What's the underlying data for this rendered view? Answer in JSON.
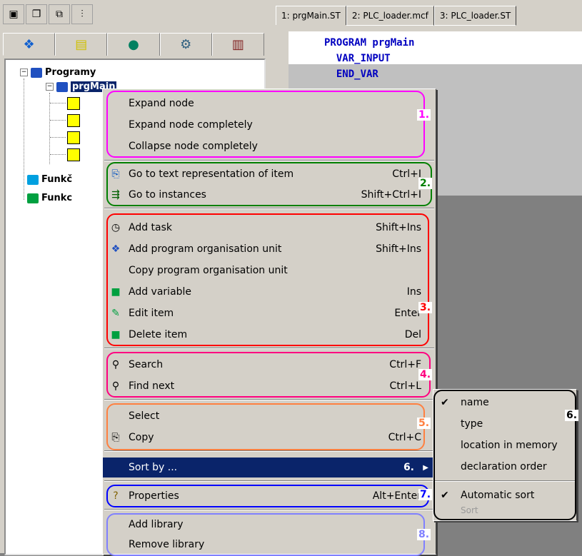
{
  "left_panel": {
    "tree": {
      "programs_label": "Programy",
      "selected_node": "prgMain",
      "functions_label_1": "Funkč",
      "functions_label_2": "Funkc"
    }
  },
  "editor": {
    "tabs": [
      {
        "label": "1: prgMain.ST"
      },
      {
        "label": "2: PLC_loader.mcf"
      },
      {
        "label": "3: PLC_loader.ST"
      }
    ],
    "code_lines": [
      {
        "text": "PROGRAM prgMain"
      },
      {
        "text": "  VAR_INPUT"
      },
      {
        "text": "  END_VAR"
      }
    ]
  },
  "context_menu": {
    "items": [
      {
        "label": "Expand node",
        "shortcut": ""
      },
      {
        "label": "Expand node completely",
        "shortcut": ""
      },
      {
        "label": "Collapse node completely",
        "shortcut": ""
      },
      {
        "label": "Go to text representation of item",
        "shortcut": "Ctrl+I"
      },
      {
        "label": "Go to instances",
        "shortcut": "Shift+Ctrl+I"
      },
      {
        "label": "Add task",
        "shortcut": "Shift+Ins"
      },
      {
        "label": "Add program organisation unit",
        "shortcut": "Shift+Ins"
      },
      {
        "label": "Copy program organisation unit",
        "shortcut": ""
      },
      {
        "label": "Add variable",
        "shortcut": "Ins"
      },
      {
        "label": "Edit item",
        "shortcut": "Enter"
      },
      {
        "label": "Delete item",
        "shortcut": "Del"
      },
      {
        "label": "Search",
        "shortcut": "Ctrl+F"
      },
      {
        "label": "Find next",
        "shortcut": "Ctrl+L"
      },
      {
        "label": "Select",
        "shortcut": ""
      },
      {
        "label": "Copy",
        "shortcut": "Ctrl+C"
      },
      {
        "label": "Sort by ...",
        "shortcut": ""
      },
      {
        "label": "Properties",
        "shortcut": "Alt+Enter"
      },
      {
        "label": "Add library",
        "shortcut": ""
      },
      {
        "label": "Remove library",
        "shortcut": ""
      }
    ],
    "groups": [
      {
        "num": "1.",
        "color": "#ff00ff"
      },
      {
        "num": "2.",
        "color": "#008000"
      },
      {
        "num": "3.",
        "color": "#ff0000"
      },
      {
        "num": "4.",
        "color": "#ff0080"
      },
      {
        "num": "5.",
        "color": "#ff8040"
      },
      {
        "num": "6.",
        "color": "#000000"
      },
      {
        "num": "7.",
        "color": "#0000ff"
      },
      {
        "num": "8.",
        "color": "#8080ff"
      }
    ]
  },
  "sort_submenu": {
    "group_num": "6.",
    "items": [
      {
        "label": "name",
        "checked": true
      },
      {
        "label": "type",
        "checked": false
      },
      {
        "label": "location in memory",
        "checked": false
      },
      {
        "label": "declaration order",
        "checked": false
      },
      {
        "label": "Automatic sort",
        "checked": true
      },
      {
        "label": "Sort",
        "checked": false
      }
    ]
  },
  "colors": {
    "menu_bg": "#d4d0c8",
    "selection": "#0a246a",
    "keyword": "#0000c0"
  }
}
